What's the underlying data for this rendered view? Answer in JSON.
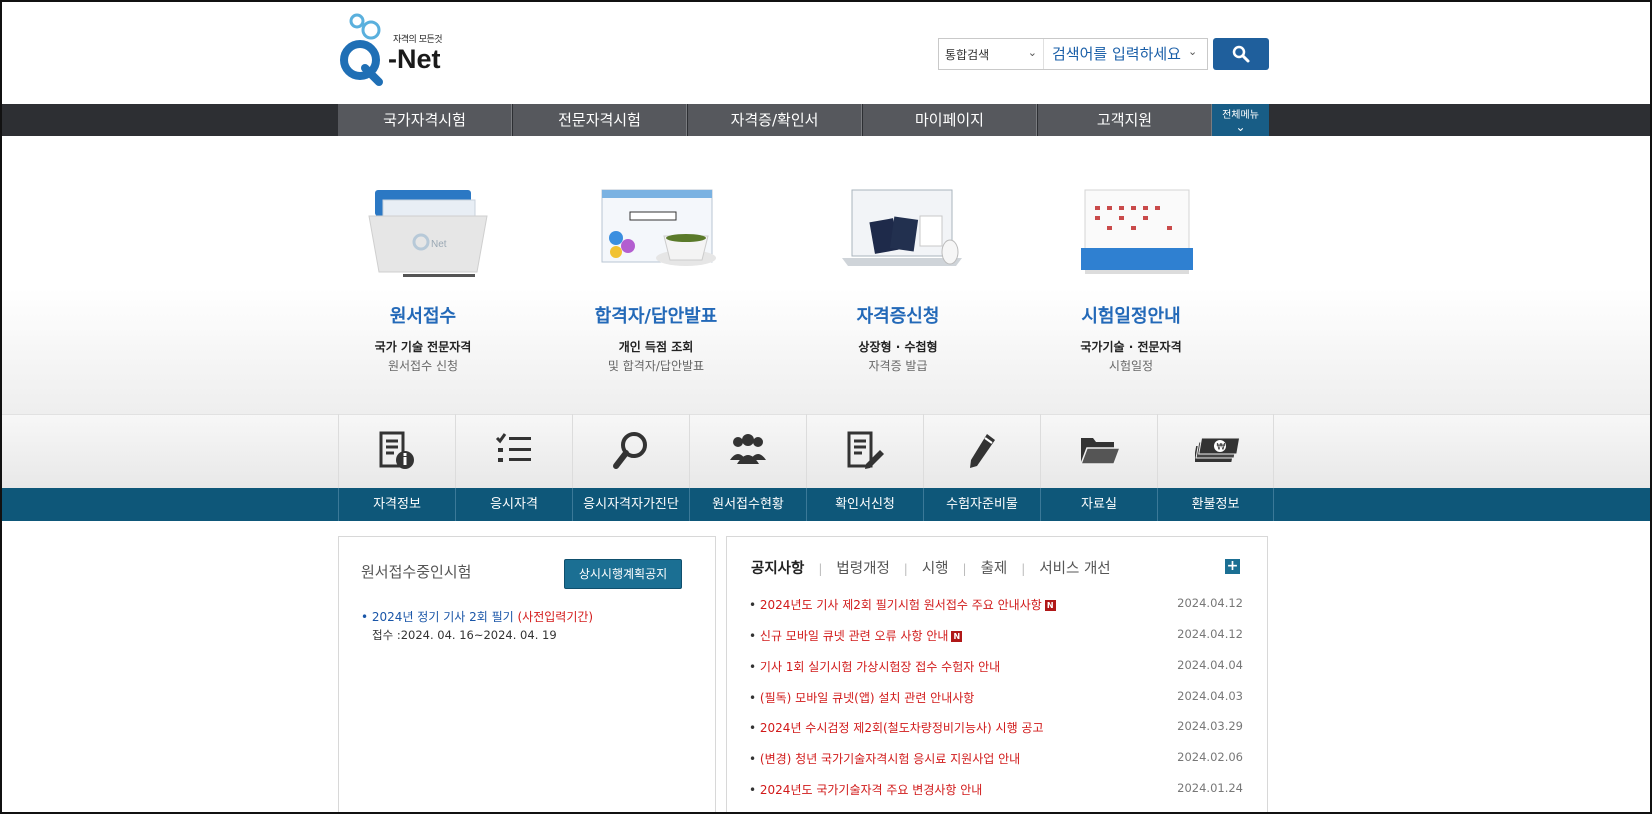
{
  "header": {
    "logo_tagline": "자격의 모든것",
    "logo_text": "-Net",
    "search_scope": "통합검색",
    "search_placeholder": "검색어를 입력하세요"
  },
  "gnb": {
    "items": [
      {
        "label": "국가자격시험"
      },
      {
        "label": "전문자격시험"
      },
      {
        "label": "자격증/확인서"
      },
      {
        "label": "마이페이지"
      },
      {
        "label": "고객지원"
      }
    ],
    "all_menu": "전체메뉴"
  },
  "visual": {
    "cards": [
      {
        "title": "원서접수",
        "sub1": "국가 기술 전문자격",
        "sub2": "원서접수 신청",
        "icon": "folder-illustration"
      },
      {
        "title": "합격자/답안발표",
        "sub1": "개인 득점 조회",
        "sub2": "및 합격자/답안발표",
        "icon": "browser-coffee-illustration"
      },
      {
        "title": "자격증신청",
        "sub1": "상장형 · 수첩형",
        "sub2": "자격증 발급",
        "icon": "laptop-passport-illustration"
      },
      {
        "title": "시험일정안내",
        "sub1": "국가기술 · 전문자격",
        "sub2": "시험일정",
        "icon": "calendar-illustration"
      }
    ]
  },
  "quick_menu": [
    {
      "label": "자격정보",
      "icon": "document-info-icon"
    },
    {
      "label": "응시자격",
      "icon": "checklist-icon"
    },
    {
      "label": "응시자격자가진단",
      "icon": "magnifier-icon"
    },
    {
      "label": "원서접수현황",
      "icon": "people-icon"
    },
    {
      "label": "확인서신청",
      "icon": "document-edit-icon"
    },
    {
      "label": "수험자준비물",
      "icon": "pencil-icon"
    },
    {
      "label": "자료실",
      "icon": "folder-icon"
    },
    {
      "label": "환불정보",
      "icon": "money-icon"
    }
  ],
  "left_panel": {
    "title": "원서접수중인시험",
    "button": "상시시행계획공지",
    "item_title": "2024년 정기 기사 2회 필기",
    "item_tag": "(사전입력기간)",
    "item_period": "접수 :2024. 04. 16~2024. 04. 19"
  },
  "right_panel": {
    "tabs": [
      "공지사항",
      "법령개정",
      "시행",
      "출제",
      "서비스 개선"
    ],
    "more_icon": "+",
    "notices": [
      {
        "title": "2024년도 기사 제2회 필기시험 원서접수 주요 안내사항",
        "date": "2024.04.12",
        "new": true
      },
      {
        "title": "신규 모바일 큐넷 관련 오류 사항 안내",
        "date": "2024.04.12",
        "new": true
      },
      {
        "title": "기사 1회 실기시험 가상시험장 접수 수험자 안내",
        "date": "2024.04.04",
        "new": false
      },
      {
        "title": "(필독) 모바일 큐넷(앱) 설치 관련 안내사항",
        "date": "2024.04.03",
        "new": false
      },
      {
        "title": "2024년 수시검정 제2회(철도차량정비기능사) 시행 공고",
        "date": "2024.03.29",
        "new": false
      },
      {
        "title": "(변경) 청년 국가기술자격시험 응시료 지원사업 안내",
        "date": "2024.02.06",
        "new": false
      },
      {
        "title": "2024년도 국가기술자격 주요 변경사항 안내",
        "date": "2024.01.24",
        "new": false
      }
    ],
    "new_badge": "N"
  },
  "colors": {
    "brand_blue": "#1f5f9c",
    "gnb_dark": "#2d2f33",
    "quick_bar": "#0e5779",
    "notice_red": "#d11a1a",
    "card_title_blue": "#2369b8"
  }
}
